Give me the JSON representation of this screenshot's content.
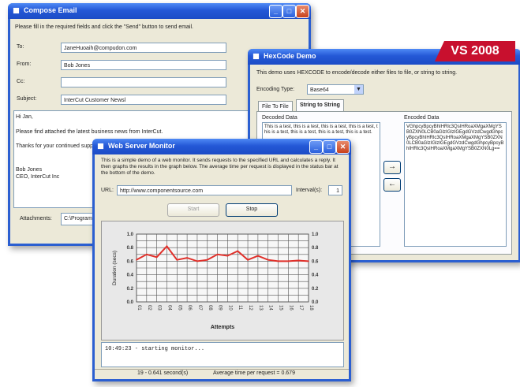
{
  "compose": {
    "title": "Compose Email",
    "instructions": "Please fill in the required fields and click the \"Send\" button to send email.",
    "to_label": "To:",
    "to_value": "JaneHuoaih@compudon.com",
    "from_label": "From:",
    "from_value": "Bob Jones",
    "cc_label": "Cc:",
    "cc_value": "",
    "subject_label": "Subject:",
    "subject_value": "InterCut Customer Newsl",
    "body_lines": [
      "Hi Jan,",
      "Please find attached the latest business news from InterCut.",
      "Thanks for your continued support",
      "Bob Jones",
      "CEO, InterCut Inc"
    ],
    "attachments_label": "Attachments:",
    "attachments_value": "C:\\Program Fi"
  },
  "hexcode": {
    "title": "HexCode Demo",
    "instructions": "This demo uses HEXCODE to encode/decode either files to file, or string to string.",
    "encoding_label": "Encoding Type:",
    "encoding_value": "Base64",
    "tabs": [
      "File To File",
      "String to String"
    ],
    "decoded_label": "Decoded Data",
    "encoded_label": "Encoded Data",
    "decoded_text": "This is a test, this is a test, this is a test, this is a test, this is a test, this is a test, this is a test, this is a test.",
    "encoded_text": "VGhpcyBpcyBhIHRlc3QsIHRoaXMgaXMgYSB0ZXN0LCB0aGlzIGlzIGEgdGVzdCwgdGhpcyBpcyBhIHRlc3QsIHRoaXMgaXMgYSB0ZXN0LCB0aGlzIGlzIGEgdGVzdCwgdGhpcyBpcyBhIHRlc3QsIHRoaXMgaXMgYSB0ZXN0Lg==",
    "encode_arrow": "→",
    "decode_arrow": "←"
  },
  "badge": {
    "text": "VS 2008"
  },
  "monitor": {
    "title": "Web Server Monitor",
    "instructions": "This is a simple demo of a web monitor. It sends requests to the specified URL and calculates a reply. It then graphs the results in the graph below. The average time per request is displayed in the status bar at the bottom of the demo.",
    "url_label": "URL:",
    "url_value": "http://www.componentsource.com",
    "interval_label": "Interval(s):",
    "interval_value": "1",
    "start_label": "Start",
    "stop_label": "Stop",
    "log_text": "10:49:23 - starting monitor...",
    "status_left": "19 - 0.641 second(s)",
    "status_right": "Average time per request = 0.679",
    "icons": [
      "app-icon",
      "minimize-icon",
      "maximize-icon",
      "close-icon"
    ]
  },
  "chart_data": {
    "type": "line",
    "title": "",
    "xlabel": "Attempts",
    "ylabel": "Duration (secs)",
    "ylim": [
      0,
      1.0
    ],
    "y_ticks": [
      "0.0",
      "0.2",
      "0.4",
      "0.6",
      "0.8",
      "1.0"
    ],
    "categories": [
      "01",
      "02",
      "03",
      "04",
      "05",
      "06",
      "07",
      "08",
      "09",
      "10",
      "11",
      "12",
      "13",
      "14",
      "15",
      "16",
      "17",
      "18"
    ],
    "series": [
      {
        "values": [
          0.62,
          0.7,
          0.66,
          0.82,
          0.62,
          0.65,
          0.6,
          0.62,
          0.7,
          0.68,
          0.75,
          0.62,
          0.68,
          0.62,
          0.6,
          0.6,
          0.61,
          0.6
        ]
      }
    ],
    "grid": true,
    "line_color": "#e0302a"
  }
}
